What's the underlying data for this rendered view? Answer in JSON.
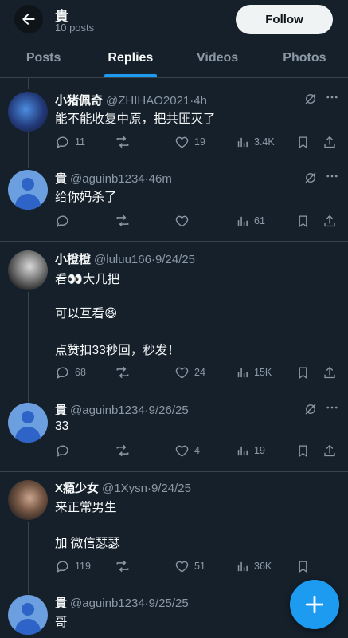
{
  "header": {
    "name": "貴",
    "subtitle": "10 posts",
    "follow_label": "Follow"
  },
  "tabs": [
    "Posts",
    "Replies",
    "Videos",
    "Photos"
  ],
  "active_tab": "Replies",
  "posts": [
    {
      "name": "小猪佩奇",
      "handle": "@ZHIHAO2021",
      "time": "4h",
      "lines": [
        "能不能收复中原，把共匪灭了"
      ],
      "replies": "11",
      "likes": "19",
      "views": "3.4K",
      "avatar": "blue-art-avatar"
    },
    {
      "name": "貴",
      "handle": "@aguinb1234",
      "time": "46m",
      "lines": [
        "给你妈杀了"
      ],
      "replies": "",
      "likes": "",
      "views": "61",
      "avatar": "default-avatar"
    },
    {
      "name": "小橙橙",
      "handle": "@luluu166",
      "time": "9/24/25",
      "lines": [
        "看👀大几把",
        "可以互看😆",
        "点赞扣33秒回，秒发！"
      ],
      "replies": "68",
      "likes": "24",
      "views": "15K",
      "avatar": "anime-girl-avatar"
    },
    {
      "name": "貴",
      "handle": "@aguinb1234",
      "time": "9/26/25",
      "lines": [
        "33"
      ],
      "replies": "",
      "likes": "4",
      "views": "19",
      "avatar": "default-avatar"
    },
    {
      "name": "X瘾少女",
      "handle": "@1Xysn",
      "time": "9/24/25",
      "lines": [
        "来正常男生",
        "加 微信瑟瑟"
      ],
      "replies": "119",
      "likes": "51",
      "views": "36K",
      "avatar": "photo-avatar"
    },
    {
      "name": "貴",
      "handle": "@aguinb1234",
      "time": "9/25/25",
      "lines": [
        "哥"
      ],
      "replies": "",
      "likes": "",
      "views": "",
      "avatar": "default-avatar"
    }
  ],
  "colors": {
    "background": "#15202b",
    "accent": "#1d9bf0",
    "muted": "#8b98a5",
    "divider": "#38444d"
  },
  "fab_icon": "plus-icon"
}
